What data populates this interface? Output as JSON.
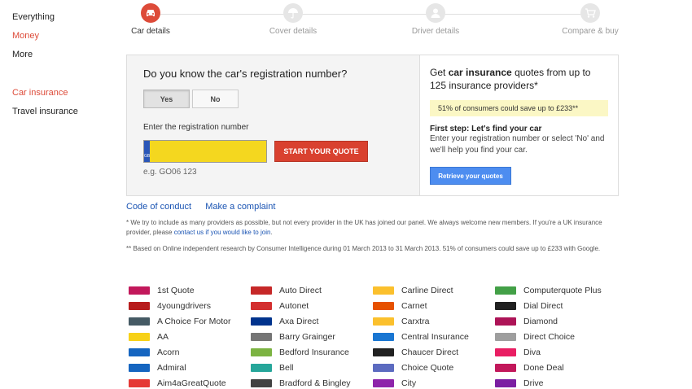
{
  "sidebar": {
    "group1": [
      "Everything",
      "Money",
      "More"
    ],
    "group2": [
      "Car insurance",
      "Travel insurance"
    ]
  },
  "steps": [
    {
      "label": "Car details",
      "icon": "car-icon"
    },
    {
      "label": "Cover details",
      "icon": "umbrella-icon"
    },
    {
      "label": "Driver details",
      "icon": "person-icon"
    },
    {
      "label": "Compare & buy",
      "icon": "cart-icon"
    }
  ],
  "form": {
    "question": "Do you know the car's registration number?",
    "yes": "Yes",
    "no": "No",
    "reg_label": "Enter the registration number",
    "plate_badge": "GB",
    "reg_value": "",
    "start_button": "START YOUR QUOTE",
    "example": "e.g. GO06 123"
  },
  "promo": {
    "title_pre": "Get ",
    "title_bold": "car insurance",
    "title_post": " quotes from up to 125 insurance providers*",
    "highlight": "51% of consumers could save up to £233**",
    "first_step": "First step: Let's find your car",
    "first_step_text": "Enter your registration number or select 'No' and we'll help you find your car.",
    "retrieve_button": "Retrieve your quotes"
  },
  "links": {
    "conduct": "Code of conduct",
    "complaint": "Make a complaint"
  },
  "notes": {
    "note1_pre": "* We try to include as many providers as possible, but not every provider in the UK has joined our panel. We always welcome new members. If you're a UK insurance provider, please ",
    "note1_link": "contact us if you would like to join",
    "note1_post": ".",
    "note2": "** Based on Online independent research by Consumer Intelligence during 01 March 2013 to 31 March 2013. 51% of consumers could save up to £233 with Google."
  },
  "providers": [
    [
      "1st Quote",
      "4youngdrivers",
      "A Choice For Motor",
      "AA",
      "Acorn",
      "Admiral",
      "Aim4aGreatQuote"
    ],
    [
      "Auto Direct",
      "Autonet",
      "Axa Direct",
      "Barry Grainger",
      "Bedford Insurance",
      "Bell",
      "Bradford & Bingley"
    ],
    [
      "Carline Direct",
      "Carnet",
      "Carxtra",
      "Central Insurance",
      "Chaucer Direct",
      "Choice Quote",
      "City"
    ],
    [
      "Computerquote Plus",
      "Dial Direct",
      "Diamond",
      "Direct Choice",
      "Diva",
      "Done Deal",
      "Drive"
    ]
  ],
  "logo_colors": [
    [
      "#c2185b",
      "#b71c1c",
      "#455a64",
      "#f7d117",
      "#1565c0",
      "#1565c0",
      "#e53935"
    ],
    [
      "#c62828",
      "#d32f2f",
      "#00338d",
      "#757575",
      "#7cb342",
      "#26a69a",
      "#424242"
    ],
    [
      "#fbc02d",
      "#e65100",
      "#fbc02d",
      "#1976d2",
      "#212121",
      "#5c6bc0",
      "#8e24aa"
    ],
    [
      "#43a047",
      "#212121",
      "#ad1457",
      "#9e9e9e",
      "#e91e63",
      "#c2185b",
      "#7b1fa2"
    ]
  ],
  "colors": {
    "accent_red": "#dd4b39",
    "link_blue": "#1a54b3",
    "button_blue": "#4d8df0",
    "plate_yellow": "#f4d71f"
  }
}
